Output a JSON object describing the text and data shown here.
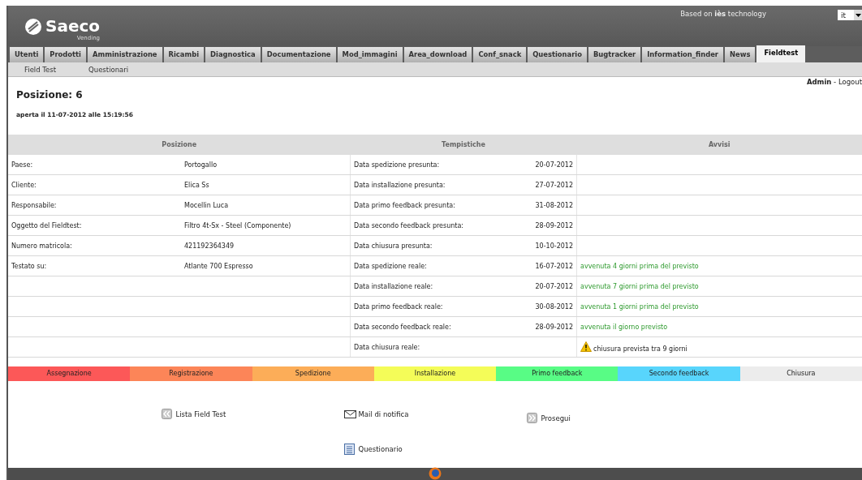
{
  "header": {
    "brand": "Saeco",
    "brand_sub": "Vending",
    "based_on": "Based on **iès** technology",
    "language": "it"
  },
  "tabs": [
    {
      "label": "Utenti",
      "selected": false
    },
    {
      "label": "Prodotti",
      "selected": false
    },
    {
      "label": "Amministrazione",
      "selected": false
    },
    {
      "label": "Ricambi",
      "selected": false
    },
    {
      "label": "Diagnostica",
      "selected": false
    },
    {
      "label": "Documentazione",
      "selected": false
    },
    {
      "label": "Mod_immagini",
      "selected": false
    },
    {
      "label": "Area_download",
      "selected": false
    },
    {
      "label": "Conf_snack",
      "selected": false
    },
    {
      "label": "Questionario",
      "selected": false
    },
    {
      "label": "Bugtracker",
      "selected": false
    },
    {
      "label": "Information_finder",
      "selected": false
    },
    {
      "label": "News",
      "selected": false
    },
    {
      "label": "Fieldtest",
      "selected": true
    }
  ],
  "subnav": [
    "Field Test",
    "Questionari"
  ],
  "user": {
    "name": "Admin",
    "separator": "-",
    "logout": "Logout"
  },
  "title": "Posizione: 6",
  "opened": "aperta il 11-07-2012 alle 15:19:56",
  "table": {
    "columns": [
      "Posizione",
      "Tempistiche",
      "Avvisi"
    ],
    "rows": [
      {
        "label": "Paese:",
        "value": "Portogallo",
        "timing": "Data spedizione presunta:",
        "date": "20-07-2012"
      },
      {
        "label": "Cliente:",
        "value": "Elica Ss",
        "timing": "Data installazione presunta:",
        "date": "27-07-2012"
      },
      {
        "label": "Responsabile:",
        "value": "Mocellin Luca",
        "timing": "Data primo feedback presunta:",
        "date": "31-08-2012"
      },
      {
        "label": "Oggetto del Fieldtest:",
        "value": "Filtro 4t-Sx - Steel (Componente)",
        "timing": "Data secondo feedback presunta:",
        "date": "28-09-2012"
      },
      {
        "label": "Numero matricola:",
        "value": "421192364349",
        "timing": "Data chiusura presunta:",
        "date": "10-10-2012"
      },
      {
        "label": "Testato su:",
        "value": "Atlante 700 Espresso",
        "timing": "Data spedizione reale:",
        "date": "16-07-2012",
        "notice": {
          "kind": "ok",
          "text": "avvenuta 4 giorni prima del previsto"
        }
      },
      {
        "timing": "Data installazione reale:",
        "date": "20-07-2012",
        "notice": {
          "kind": "ok",
          "text": "avvenuta 7 giorni prima del previsto"
        }
      },
      {
        "timing": "Data primo feedback reale:",
        "date": "30-08-2012",
        "notice": {
          "kind": "ok",
          "text": "avvenuta 1 giorni prima del previsto"
        }
      },
      {
        "timing": "Data secondo feedback reale:",
        "date": "28-09-2012",
        "notice": {
          "kind": "ok",
          "text": "avvenuta il giorno previsto"
        }
      },
      {
        "timing": "Data chiusura reale:",
        "notice": {
          "kind": "warning",
          "text": "chiusura prevista tra 9 giorni"
        }
      }
    ]
  },
  "stages": [
    {
      "label": "Assegnazione",
      "color": "#fc5858"
    },
    {
      "label": "Registrazione",
      "color": "#fc8558"
    },
    {
      "label": "Spedizione",
      "color": "#fcad58"
    },
    {
      "label": "Installazione",
      "color": "#f4fc58"
    },
    {
      "label": "Primo feedback",
      "color": "#58fc85"
    },
    {
      "label": "Secondo feedback",
      "color": "#58d5fc"
    },
    {
      "label": "Chiusura",
      "color": "#ececec"
    }
  ],
  "actions": [
    {
      "kind": "back",
      "label": "Lista Field Test"
    },
    {
      "kind": "mail",
      "label": "Mail di notifica"
    },
    {
      "kind": "next",
      "label": "Prosegui"
    },
    {
      "kind": "form",
      "label": "Questionario"
    }
  ]
}
